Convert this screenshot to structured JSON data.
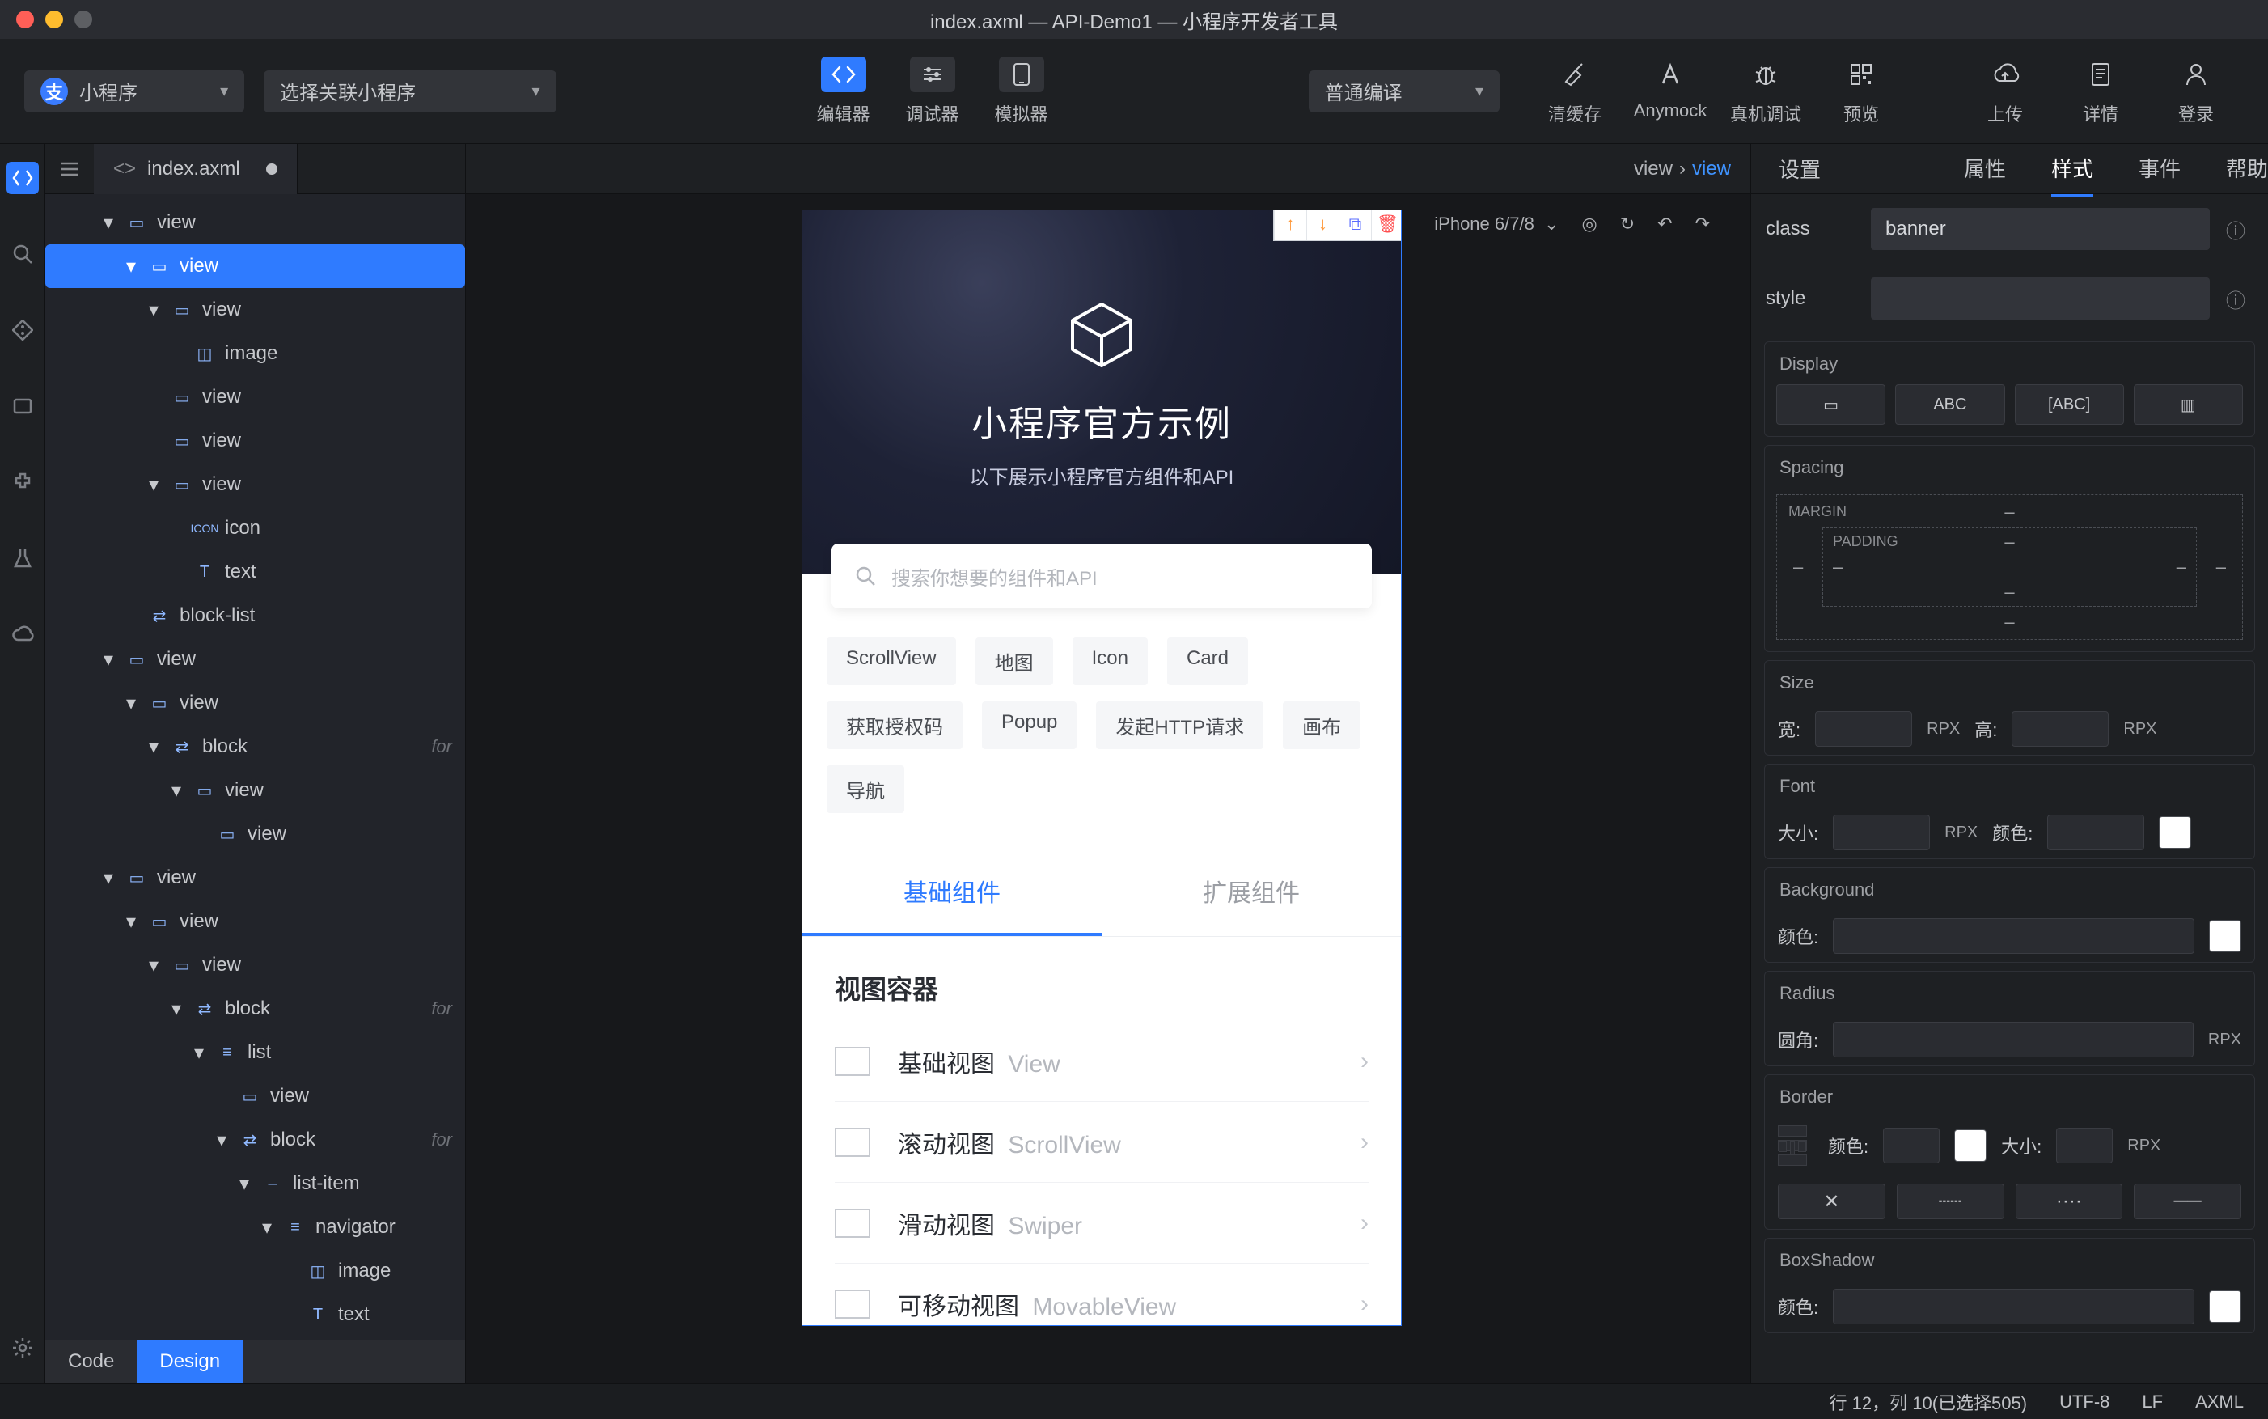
{
  "title": "index.axml — API-Demo1 — 小程序开发者工具",
  "topbar": {
    "selA": "小程序",
    "selB": "选择关联小程序",
    "compile": "普通编译",
    "mid": [
      {
        "key": "editor",
        "label": "编辑器"
      },
      {
        "key": "debugger",
        "label": "调试器"
      },
      {
        "key": "simulator",
        "label": "模拟器"
      }
    ],
    "right": [
      {
        "key": "clearcache",
        "label": "清缓存"
      },
      {
        "key": "anymock",
        "label": "Anymock"
      },
      {
        "key": "realdebug",
        "label": "真机调试"
      },
      {
        "key": "preview",
        "label": "预览"
      },
      {
        "key": "upload",
        "label": "上传"
      },
      {
        "key": "details",
        "label": "详情"
      },
      {
        "key": "login",
        "label": "登录"
      }
    ]
  },
  "filetab": "index.axml",
  "breadcrumb": {
    "a": "view",
    "b": "view"
  },
  "tree": [
    {
      "ind": 1,
      "chev": "▾",
      "icon": "▭",
      "label": "view"
    },
    {
      "ind": 2,
      "chev": "▾",
      "icon": "▭",
      "label": "view",
      "sel": true
    },
    {
      "ind": 3,
      "chev": "▾",
      "icon": "▭",
      "label": "view"
    },
    {
      "ind": 4,
      "chev": "",
      "icon": "◫",
      "label": "image"
    },
    {
      "ind": 3,
      "chev": "",
      "icon": "▭",
      "label": "view"
    },
    {
      "ind": 3,
      "chev": "",
      "icon": "▭",
      "label": "view"
    },
    {
      "ind": 3,
      "chev": "▾",
      "icon": "▭",
      "label": "view"
    },
    {
      "ind": 4,
      "chev": "",
      "icon": "ICON",
      "label": "icon"
    },
    {
      "ind": 4,
      "chev": "",
      "icon": "T",
      "label": "text"
    },
    {
      "ind": 2,
      "chev": "",
      "icon": "⇄",
      "label": "block-list"
    },
    {
      "ind": 1,
      "chev": "▾",
      "icon": "▭",
      "label": "view"
    },
    {
      "ind": 2,
      "chev": "▾",
      "icon": "▭",
      "label": "view"
    },
    {
      "ind": 3,
      "chev": "▾",
      "icon": "⇄",
      "label": "block",
      "faded": "for"
    },
    {
      "ind": 4,
      "chev": "▾",
      "icon": "▭",
      "label": "view"
    },
    {
      "ind": 5,
      "chev": "",
      "icon": "▭",
      "label": "view"
    },
    {
      "ind": 1,
      "chev": "▾",
      "icon": "▭",
      "label": "view"
    },
    {
      "ind": 2,
      "chev": "▾",
      "icon": "▭",
      "label": "view"
    },
    {
      "ind": 3,
      "chev": "▾",
      "icon": "▭",
      "label": "view"
    },
    {
      "ind": 4,
      "chev": "▾",
      "icon": "⇄",
      "label": "block",
      "faded": "for"
    },
    {
      "ind": 5,
      "chev": "▾",
      "icon": "≡",
      "label": "list"
    },
    {
      "ind": 6,
      "chev": "",
      "icon": "▭",
      "label": "view"
    },
    {
      "ind": 6,
      "chev": "▾",
      "icon": "⇄",
      "label": "block",
      "faded": "for"
    },
    {
      "ind": 7,
      "chev": "▾",
      "icon": "–",
      "label": "list-item"
    },
    {
      "ind": 8,
      "chev": "▾",
      "icon": "≡",
      "label": "navigator"
    },
    {
      "ind": 9,
      "chev": "",
      "icon": "◫",
      "label": "image"
    },
    {
      "ind": 9,
      "chev": "",
      "icon": "T",
      "label": "text"
    }
  ],
  "switch": {
    "code": "Code",
    "design": "Design"
  },
  "sim": {
    "device": "iPhone 6/7/8",
    "banner_title": "小程序官方示例",
    "banner_sub": "以下展示小程序官方组件和API",
    "search_ph": "搜索你想要的组件和API",
    "chips": [
      "ScrollView",
      "地图",
      "Icon",
      "Card",
      "获取授权码",
      "Popup",
      "发起HTTP请求",
      "画布",
      "导航"
    ],
    "tabs": {
      "a": "基础组件",
      "b": "扩展组件"
    },
    "section": "视图容器",
    "items": [
      {
        "cn": "基础视图",
        "en": "View"
      },
      {
        "cn": "滚动视图",
        "en": "ScrollView"
      },
      {
        "cn": "滑动视图",
        "en": "Swiper"
      },
      {
        "cn": "可移动视图",
        "en": "MovableView"
      }
    ]
  },
  "inspector": {
    "settings": "设置",
    "tabs": {
      "attr": "属性",
      "style": "样式",
      "event": "事件",
      "help": "帮助"
    },
    "class_lbl": "class",
    "class_val": "banner",
    "style_lbl": "style",
    "display_lbl": "Display",
    "disp_opts": [
      "▭",
      "ABC",
      "[ABC]",
      "▥"
    ],
    "spacing_lbl": "Spacing",
    "margin_lbl": "MARGIN",
    "padding_lbl": "PADDING",
    "size_lbl": "Size",
    "w_lbl": "宽:",
    "h_lbl": "高:",
    "rpx": "RPX",
    "font_lbl": "Font",
    "fsize_lbl": "大小:",
    "fcolor_lbl": "颜色:",
    "bg_lbl": "Background",
    "bgcolor_lbl": "颜色:",
    "radius_lbl": "Radius",
    "rcorner_lbl": "圆角:",
    "border_lbl": "Border",
    "bcolor_lbl": "颜色:",
    "bsize_lbl": "大小:",
    "bs_lbl": "BoxShadow",
    "bs_color_lbl": "颜色:"
  },
  "status": {
    "pos": "行 12，列 10(已选择505)",
    "enc": "UTF-8",
    "eol": "LF",
    "lang": "AXML"
  }
}
